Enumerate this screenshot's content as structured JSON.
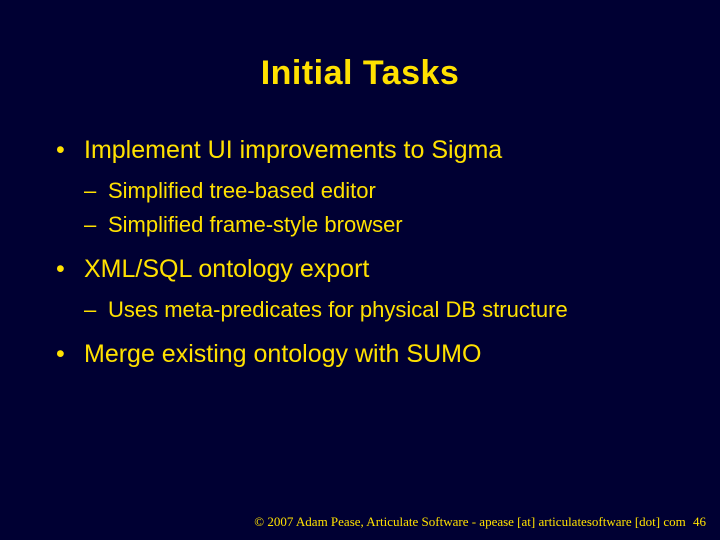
{
  "title": "Initial Tasks",
  "bullets": {
    "b1": {
      "text": "Implement UI improvements to Sigma",
      "sub1": "Simplified tree-based editor",
      "sub2": "Simplified frame-style browser"
    },
    "b2": {
      "text": "XML/SQL ontology export",
      "sub1": "Uses meta-predicates for physical DB structure"
    },
    "b3": {
      "text": "Merge existing ontology with SUMO"
    }
  },
  "footer": {
    "copyright": "© 2007 Adam Pease, Articulate Software - apease [at] articulatesoftware [dot] com",
    "page": "46"
  }
}
